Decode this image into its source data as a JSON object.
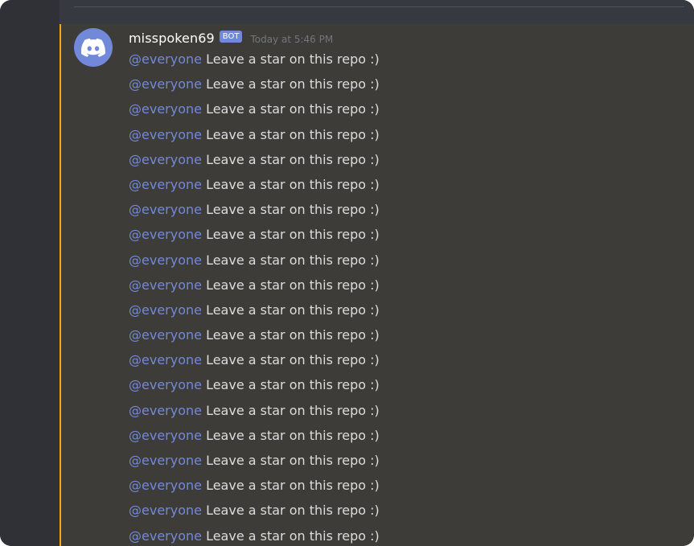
{
  "colors": {
    "background": "#36393f",
    "gutter": "#2f3136",
    "mention_highlight": "#3e3c39",
    "highlight_bar": "#faa61a",
    "accent": "#7289da",
    "username": "#ffffff",
    "timestamp": "#72767d",
    "text": "#dcddde"
  },
  "author": {
    "avatar_icon": "discord-logo-icon",
    "username": "misspoken69",
    "tag": "BOT",
    "timestamp": "Today at 5:46 PM"
  },
  "messages": [
    {
      "mention": "@everyone",
      "text": " Leave a star on this repo :)"
    },
    {
      "mention": "@everyone",
      "text": " Leave a star on this repo :)"
    },
    {
      "mention": "@everyone",
      "text": " Leave a star on this repo :)"
    },
    {
      "mention": "@everyone",
      "text": " Leave a star on this repo :)"
    },
    {
      "mention": "@everyone",
      "text": " Leave a star on this repo :)"
    },
    {
      "mention": "@everyone",
      "text": " Leave a star on this repo :)"
    },
    {
      "mention": "@everyone",
      "text": " Leave a star on this repo :)"
    },
    {
      "mention": "@everyone",
      "text": " Leave a star on this repo :)"
    },
    {
      "mention": "@everyone",
      "text": " Leave a star on this repo :)"
    },
    {
      "mention": "@everyone",
      "text": " Leave a star on this repo :)"
    },
    {
      "mention": "@everyone",
      "text": " Leave a star on this repo :)"
    },
    {
      "mention": "@everyone",
      "text": " Leave a star on this repo :)"
    },
    {
      "mention": "@everyone",
      "text": " Leave a star on this repo :)"
    },
    {
      "mention": "@everyone",
      "text": " Leave a star on this repo :)"
    },
    {
      "mention": "@everyone",
      "text": " Leave a star on this repo :)"
    },
    {
      "mention": "@everyone",
      "text": " Leave a star on this repo :)"
    },
    {
      "mention": "@everyone",
      "text": " Leave a star on this repo :)"
    },
    {
      "mention": "@everyone",
      "text": " Leave a star on this repo :)"
    },
    {
      "mention": "@everyone",
      "text": " Leave a star on this repo :)"
    },
    {
      "mention": "@everyone",
      "text": " Leave a star on this repo :)"
    }
  ]
}
